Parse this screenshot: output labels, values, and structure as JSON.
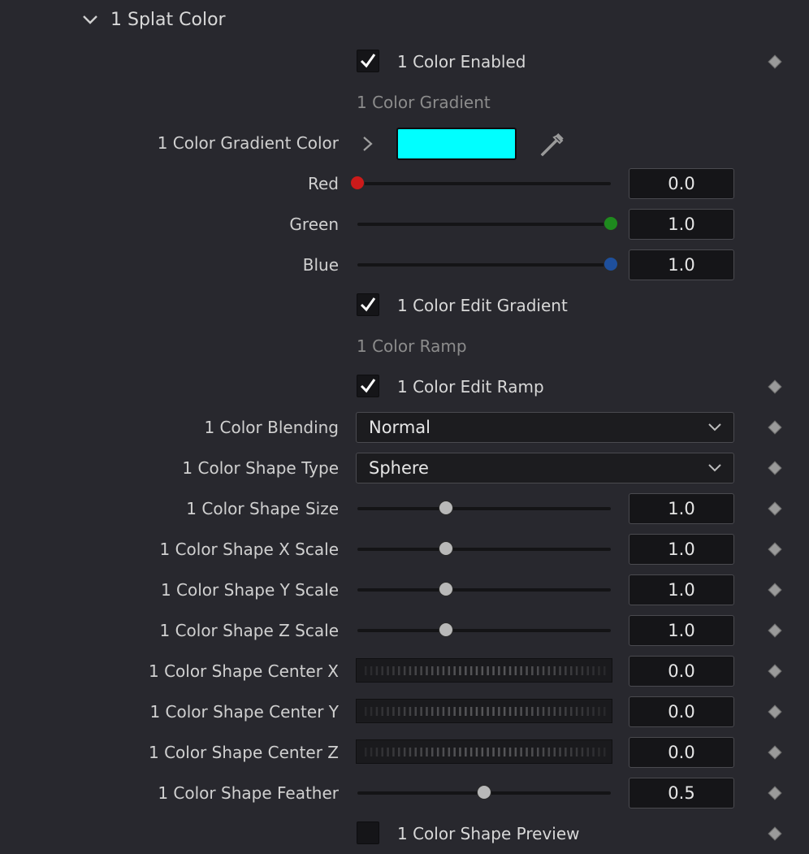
{
  "section": {
    "title": "1 Splat Color"
  },
  "colors": {
    "swatch": "#00ffff",
    "red_knob": "#cc1a1a",
    "green_knob": "#1e8a1e",
    "blue_knob": "#1e4f9c"
  },
  "color_enabled": {
    "label": "1 Color Enabled",
    "checked": true
  },
  "gradient_heading": "1 Color Gradient",
  "gradient_color": {
    "label": "1 Color Gradient Color"
  },
  "red": {
    "label": "Red",
    "value": "0.0",
    "fraction": 0.0
  },
  "green": {
    "label": "Green",
    "value": "1.0",
    "fraction": 1.0
  },
  "blue": {
    "label": "Blue",
    "value": "1.0",
    "fraction": 1.0
  },
  "edit_gradient": {
    "label": "1 Color Edit Gradient",
    "checked": true
  },
  "ramp_heading": "1 Color Ramp",
  "edit_ramp": {
    "label": "1 Color Edit Ramp",
    "checked": true
  },
  "blending": {
    "label": "1 Color Blending",
    "value": "Normal"
  },
  "shape_type": {
    "label": "1 Color Shape Type",
    "value": "Sphere"
  },
  "shape_size": {
    "label": "1 Color Shape Size",
    "value": "1.0",
    "fraction": 0.35
  },
  "shape_x_scale": {
    "label": "1 Color Shape X Scale",
    "value": "1.0",
    "fraction": 0.35
  },
  "shape_y_scale": {
    "label": "1 Color Shape Y Scale",
    "value": "1.0",
    "fraction": 0.35
  },
  "shape_z_scale": {
    "label": "1 Color Shape Z Scale",
    "value": "1.0",
    "fraction": 0.35
  },
  "shape_center_x": {
    "label": "1 Color Shape Center X",
    "value": "0.0"
  },
  "shape_center_y": {
    "label": "1 Color Shape Center Y",
    "value": "0.0"
  },
  "shape_center_z": {
    "label": "1 Color Shape Center Z",
    "value": "0.0"
  },
  "shape_feather": {
    "label": "1 Color Shape Feather",
    "value": "0.5",
    "fraction": 0.5
  },
  "shape_preview": {
    "label": "1 Color Shape Preview",
    "checked": false
  }
}
